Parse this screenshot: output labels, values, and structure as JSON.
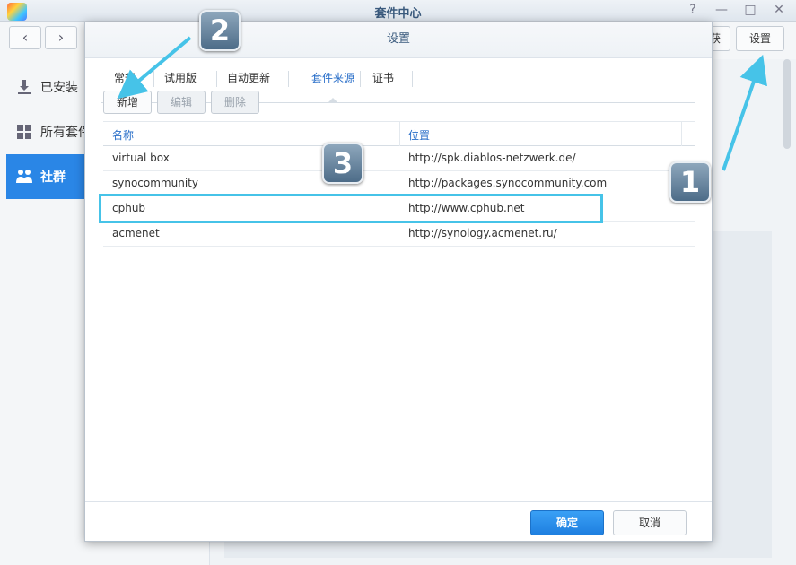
{
  "window": {
    "title": "套件中心",
    "help_icon": "?",
    "minimize_icon": "—",
    "maximize_icon": "□",
    "close_icon": "✕"
  },
  "toolbar": {
    "back_icon": "‹",
    "forward_icon": "›",
    "hidden_button_fragment": "获",
    "settings_label": "设置"
  },
  "sidebar": {
    "items": [
      {
        "label": "已安装",
        "icon": "download-icon"
      },
      {
        "label": "所有套件",
        "icon": "grid-icon"
      },
      {
        "label": "社群",
        "icon": "community-icon"
      }
    ]
  },
  "dialog": {
    "title": "设置",
    "tabs": [
      "常规",
      "试用版",
      "自动更新",
      "套件来源",
      "证书"
    ],
    "active_tab": "套件来源",
    "buttons": {
      "add": "新增",
      "edit": "编辑",
      "delete": "删除"
    },
    "columns": {
      "name": "名称",
      "location": "位置"
    },
    "rows": [
      {
        "name": "virtual box",
        "location": "http://spk.diablos-netzwerk.de/"
      },
      {
        "name": "synocommunity",
        "location": "http://packages.synocommunity.com"
      },
      {
        "name": "cphub",
        "location": "http://www.cphub.net"
      },
      {
        "name": "acmenet",
        "location": "http://synology.acmenet.ru/"
      }
    ],
    "ok_label": "确定",
    "cancel_label": "取消"
  },
  "annotations": {
    "badge1": "1",
    "badge2": "2",
    "badge3": "3",
    "accent_color": "#46c3e8"
  }
}
